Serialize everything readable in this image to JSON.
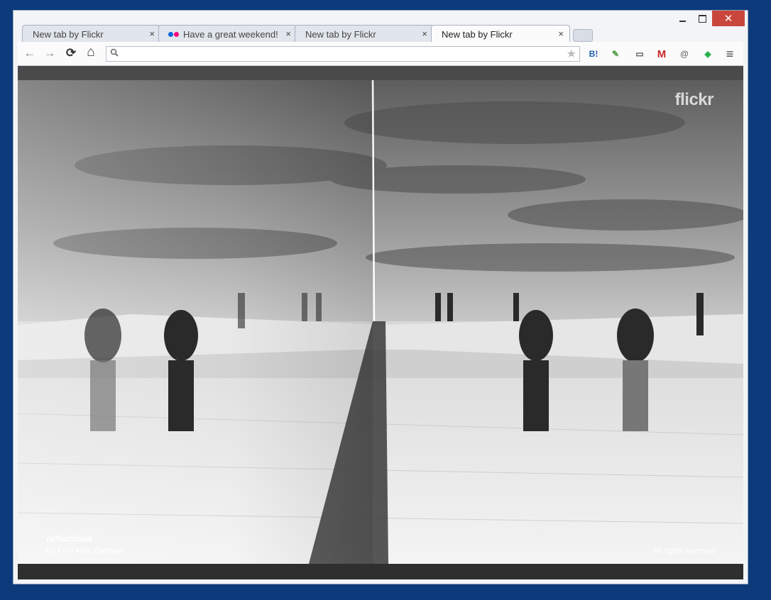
{
  "tabs": [
    {
      "label": "New tab by Flickr",
      "close": "×",
      "active": false
    },
    {
      "label": "Have a great weekend!",
      "close": "×",
      "active": false
    },
    {
      "label": "New tab by Flickr",
      "close": "×",
      "active": false
    },
    {
      "label": "New tab by Flickr",
      "close": "×",
      "active": true
    }
  ],
  "window_controls": {
    "close": "✕"
  },
  "toolbar": {
    "back_icon": "←",
    "forward_icon": "→",
    "reload_icon": "⟳",
    "home_icon": "⌂",
    "omnibox_value": "",
    "star_icon": "★",
    "extensions": [
      {
        "name": "hatena-bookmark-icon",
        "glyph": "B!",
        "color": "#1f5da8"
      },
      {
        "name": "evernote-icon",
        "glyph": "✎",
        "color": "#4a9b3a"
      },
      {
        "name": "ruler-icon",
        "glyph": "▭",
        "color": "#555555"
      },
      {
        "name": "gmail-icon",
        "glyph": "M",
        "color": "#c62828"
      },
      {
        "name": "mail-checker-icon",
        "glyph": "@",
        "color": "#666666"
      },
      {
        "name": "feedly-icon",
        "glyph": "◆",
        "color": "#2bb24c"
      }
    ],
    "menu_icon": "≡"
  },
  "page": {
    "brand": "flickr",
    "photo_title": "reflections",
    "photo_author": "By Knut Arne Gjertsen",
    "rights": "All rights reserved"
  },
  "colors": {
    "desktop": "#0c3a7a",
    "close_button": "#c9463d",
    "flickr_blue": "#0063dc",
    "flickr_pink": "#ff0084"
  }
}
